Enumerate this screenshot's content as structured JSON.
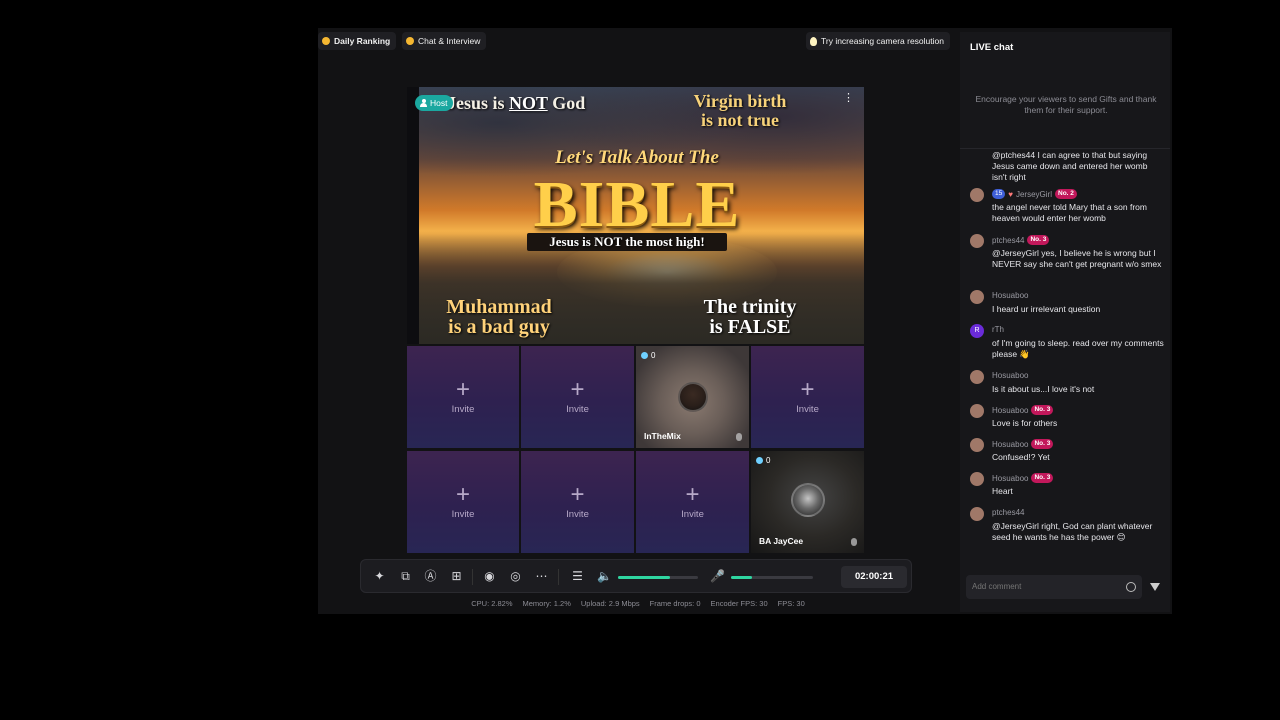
{
  "topbar": {
    "daily_ranking": "Daily Ranking",
    "chat_interview": "Chat & Interview",
    "tip": "Try increasing camera resolution"
  },
  "hero": {
    "host_label": "Host",
    "line1_prefix": "Jesus is ",
    "line1_not": "NOT",
    "line1_suffix": " God",
    "virgin": "Virgin birth\nis not true",
    "lets_talk": "Let's Talk About The",
    "bible": "BIBLE",
    "subtitle": "Jesus is NOT the most high!",
    "muhammad": "Muhammad\nis a bad guy",
    "trinity": "The trinity\nis FALSE"
  },
  "grid": {
    "invite_label": "Invite",
    "guest1": {
      "name": "InTheMix",
      "gifts": "0"
    },
    "guest2": {
      "name": "BA JayCee",
      "gifts": "0"
    }
  },
  "toolbar": {
    "timer": "02:00:21",
    "speaker_volume": 0.65,
    "mic_volume": 0.25
  },
  "stats": {
    "cpu": "CPU:  2.82%",
    "memory": "Memory:  1.2%",
    "upload": "Upload:  2.9 Mbps",
    "frame_drops": "Frame drops:  0",
    "encoder_fps": "Encoder FPS:  30",
    "fps": "FPS:  30"
  },
  "chat": {
    "title": "LIVE chat",
    "hint": "Encourage your viewers to send Gifts and thank them for their support.",
    "input_placeholder": "Add comment",
    "messages": [
      {
        "user": "",
        "text": "@ptches44 I can agree to that but saying Jesus came down and entered her womb isn't right"
      },
      {
        "user": "JerseyGirl",
        "level": "15",
        "rank": "No. 2",
        "text": "the angel never told Mary that a son from heaven would enter her womb"
      },
      {
        "user": "ptches44",
        "rank": "No. 3",
        "text": "@JerseyGirl yes, I believe he is wrong but I NEVER say she can't get pregnant w/o smex"
      },
      {
        "user": "Hosuaboo",
        "text": "I heard ur irrelevant question"
      },
      {
        "user": "rTh",
        "avatar_letter": "R",
        "text": "of I'm going to sleep. read over my comments please 👋"
      },
      {
        "user": "Hosuaboo",
        "text": "Is it about us...I love it's not"
      },
      {
        "user": "Hosuaboo",
        "rank": "No. 3",
        "text": "Love is for others"
      },
      {
        "user": "Hosuaboo",
        "rank": "No. 3",
        "text": "Confused!? Yet"
      },
      {
        "user": "Hosuaboo",
        "rank": "No. 3",
        "text": "Heart"
      },
      {
        "user": "ptches44",
        "text": "@JerseyGirl right, God can plant whatever seed he wants he has the power 😊"
      }
    ]
  },
  "colors": {
    "accent": "#2fd6a1",
    "host_badge": "#1ba8a0",
    "rank_badge": "#c2185b"
  }
}
